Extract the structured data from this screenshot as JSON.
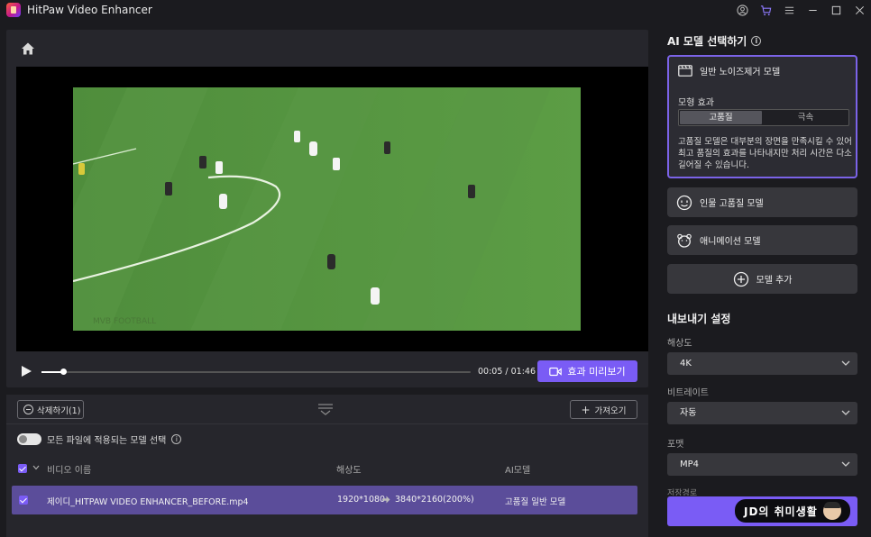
{
  "app": {
    "title": "HitPaw Video Enhancer"
  },
  "titlebar_icons": [
    "user-icon",
    "cart-icon",
    "menu-icon",
    "minimize-icon",
    "maximize-icon",
    "close-icon"
  ],
  "player": {
    "time": "00:05 / 01:46",
    "preview_label": "효과 미리보기",
    "progress": 0.05,
    "video_watermark": "MVB FOOTBALL"
  },
  "filelist": {
    "delete_label": "삭제하기(1)",
    "import_label": "가져오기",
    "toggle_label": "모든 파일에 적용되는 모델 선택",
    "columns": {
      "name": "비디오 이름",
      "resolution": "해상도",
      "model": "AI모델"
    },
    "rows": [
      {
        "name": "제이디_HITPAW VIDEO ENHANCER_BEFORE.mp4",
        "from": "1920*1080",
        "to": "3840*2160(200%)",
        "model": "고품질 일반 모델"
      }
    ]
  },
  "sidebar": {
    "title": "AI 모델 선택하기",
    "active_model": {
      "name": "일반 노이즈제거 모델",
      "effect_label": "모형 효과",
      "options": [
        "고품질",
        "극속"
      ],
      "selected": "고품질",
      "description": "고품질 모델은 대부분의 장면을 만족시킬 수 있어 최고 품질의 효과를 나타내지만 처리 시간은 다소 길어질 수 있습니다."
    },
    "models": [
      "인물 고품질 모델",
      "애니메이션 모델"
    ],
    "add_model": "모델 추가",
    "export": {
      "title": "내보내기 설정",
      "resolution_label": "해상도",
      "resolution_value": "4K",
      "bitrate_label": "비트레이트",
      "bitrate_value": "자동",
      "format_label": "포맷",
      "format_value": "MP4",
      "cut_label": "저장경로"
    },
    "watermark_text": "JD의 취미생활"
  },
  "colors": {
    "accent": "#7a5cf5",
    "selected_row": "#5b4d9a",
    "panel": "#26262c",
    "background": "#1b1b1f"
  }
}
